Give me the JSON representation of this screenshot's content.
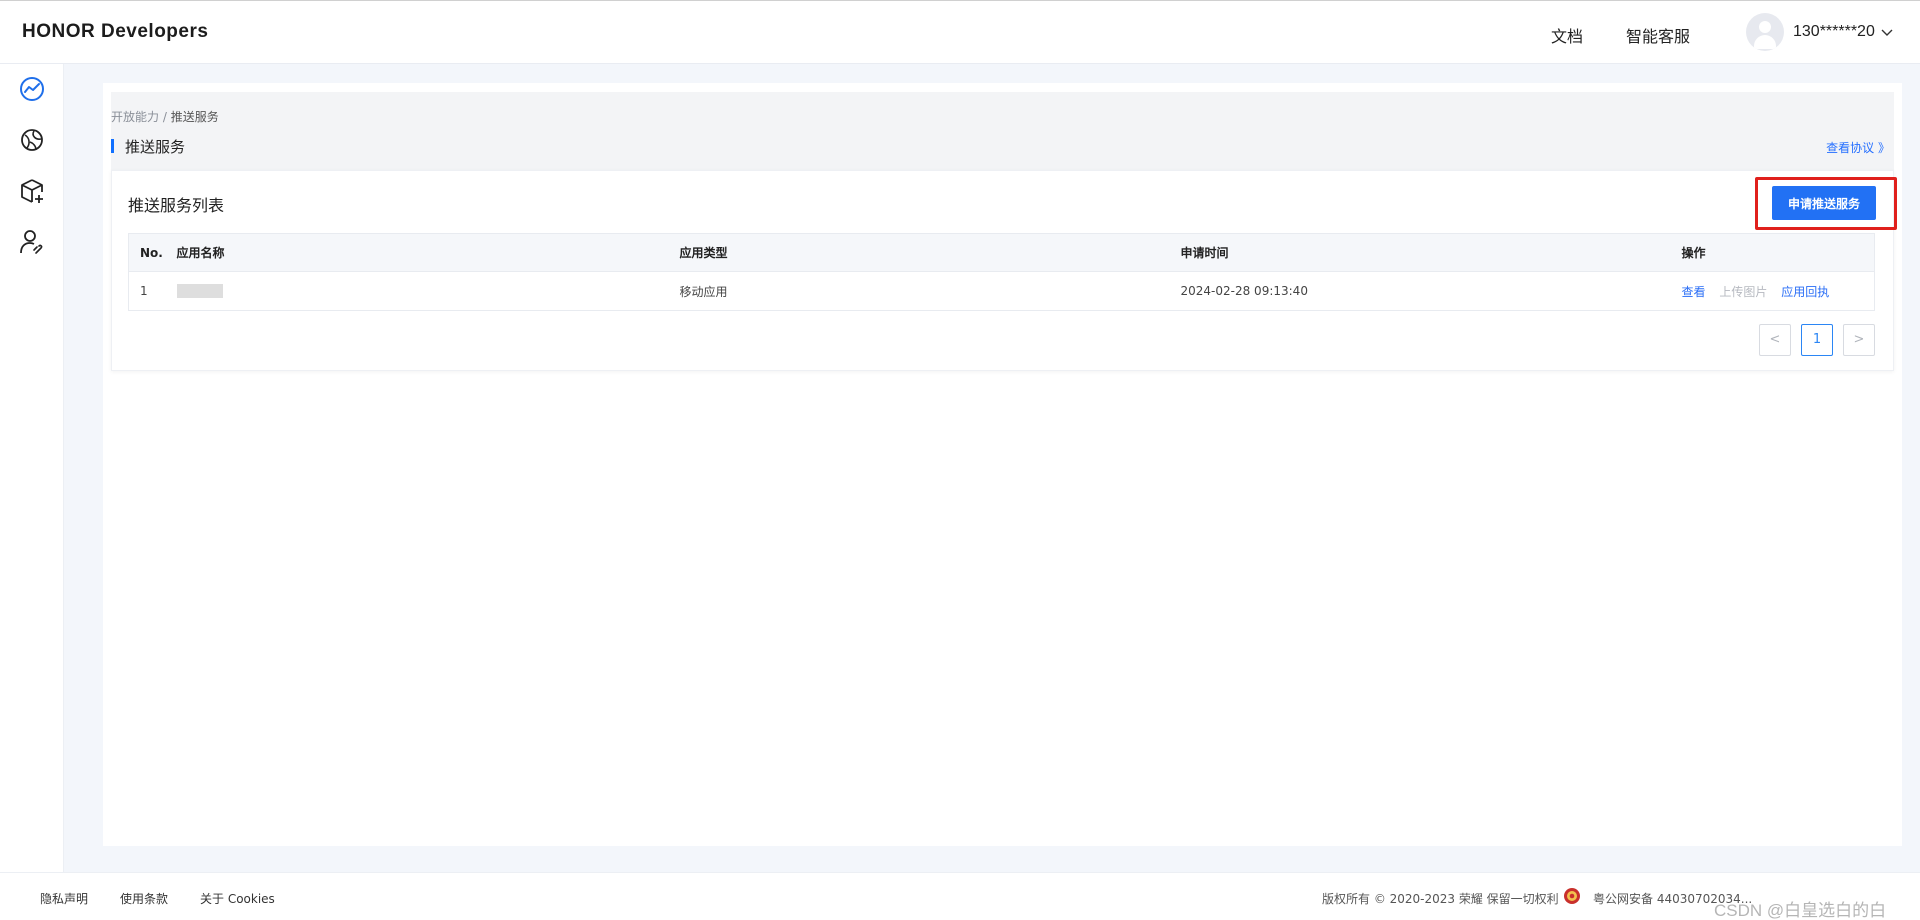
{
  "header": {
    "brand": "HONOR Developers",
    "nav": [
      "文档",
      "智能客服"
    ],
    "user": "130******20"
  },
  "sidebar": {
    "icons": [
      "trend-chart-icon",
      "planet-icon",
      "cube-add-icon",
      "user-link-icon"
    ],
    "expand_icon": "chevron-right-circle-icon"
  },
  "breadcrumb": {
    "parent": "开放能力",
    "separator": "/",
    "current": "推送服务"
  },
  "section": {
    "title": "推送服务",
    "agreement_link": "查看协议 》"
  },
  "card": {
    "title": "推送服务列表",
    "apply_button": "申请推送服务"
  },
  "table": {
    "headers": [
      "No.",
      "应用名称",
      "应用类型",
      "申请时间",
      "操作"
    ],
    "rows": [
      {
        "no": "1",
        "name": "",
        "type": "移动应用",
        "time": "2024-02-28 09:13:40",
        "actions": [
          "查看",
          "上传图片",
          "应用回执"
        ]
      }
    ]
  },
  "pagination": {
    "prev": "<",
    "current": "1",
    "next": ">"
  },
  "footer": {
    "links": [
      "隐私声明",
      "使用条款",
      "关于 Cookies"
    ],
    "copyright": "版权所有 © 2020-2023 荣耀 保留一切权利",
    "icp": "粤公网安备 44030702034..."
  },
  "watermark": "CSDN @白皇选白的白",
  "colors": {
    "accent": "#2271f4",
    "highlight": "#e0201c",
    "link": "#2a6ef6"
  }
}
